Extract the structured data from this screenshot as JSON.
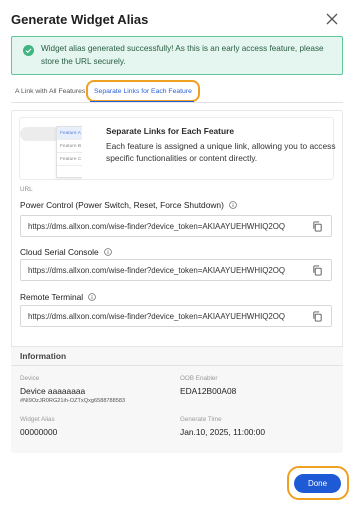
{
  "dialog": {
    "title": "Generate Widget Alias"
  },
  "banner": {
    "message": "Widget alias generated successfully! As this is an early access feature, please store the URL securely.",
    "color": "#5fc79a"
  },
  "tabs": [
    {
      "label": "A Link with All Features",
      "active": false
    },
    {
      "label": "Separate Links for Each Feature",
      "active": true
    }
  ],
  "feature_card": {
    "illustration_items": [
      "Feature A",
      "Feature B",
      "Feature C"
    ],
    "title": "Separate Links for Each Feature",
    "description": "Each feature is assigned a unique link, allowing you to access specific functionalities or content directly."
  },
  "url_section": {
    "header": "URL",
    "fields": [
      {
        "label": "Power Control (Power Switch, Reset, Force Shutdown)",
        "value": "https://dms.allxon.com/wise-finder?device_token=AKIAAYUEHWHIQ2OQ"
      },
      {
        "label": "Cloud Serial Console",
        "value": "https://dms.allxon.com/wise-finder?device_token=AKIAAYUEHWHIQ2OQ"
      },
      {
        "label": "Remote Terminal",
        "value": "https://dms.allxon.com/wise-finder?device_token=AKIAAYUEHWHIQ2OQ"
      }
    ]
  },
  "information": {
    "title": "Information",
    "device_label": "Device",
    "device_value": "Device aaaaaaaa",
    "device_id": "#NI9OzJR0RG21ih-OZTxQxg6588788583",
    "oob_label": "OOB Enabler",
    "oob_value": "EDA12B00A08",
    "alias_label": "Widget Alias",
    "alias_value": "00000000",
    "time_label": "Generate Time",
    "time_value": "Jan.10, 2025, 11:00:00"
  },
  "footer": {
    "done_label": "Done"
  },
  "colors": {
    "accent": "#1f5ad6",
    "highlight": "#f0a020",
    "success_bg": "#e4f6ef"
  }
}
